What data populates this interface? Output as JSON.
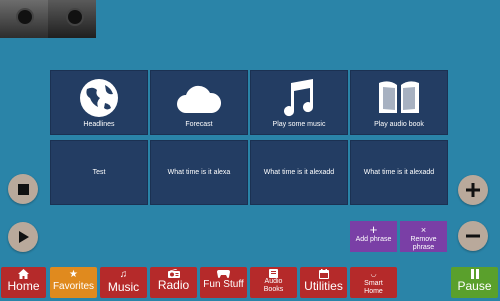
{
  "tiles": [
    {
      "label": "Headlines",
      "icon": "globe-icon"
    },
    {
      "label": "Forecast",
      "icon": "cloud-icon"
    },
    {
      "label": "Play some music",
      "icon": "music-note-icon"
    },
    {
      "label": "Play audio book",
      "icon": "book-icon"
    },
    {
      "label": "Test",
      "icon": ""
    },
    {
      "label": "What time is it alexa",
      "icon": ""
    },
    {
      "label": "What time is it alexadd",
      "icon": ""
    },
    {
      "label": "What time is it alexadd",
      "icon": ""
    }
  ],
  "phrases": {
    "add": "Add phrase",
    "remove": "Remove phrase",
    "add_symbol": "+",
    "remove_symbol": "×"
  },
  "nav": [
    {
      "label": "Home",
      "icon": "home-icon"
    },
    {
      "label": "Favorites",
      "icon": "star-icon"
    },
    {
      "label": "Music",
      "icon": "music-icon"
    },
    {
      "label": "Radio",
      "icon": "radio-icon"
    },
    {
      "label": "Fun Stuff",
      "icon": "gamepad-icon"
    },
    {
      "label": "Audio Books",
      "icon": "audiobook-icon"
    },
    {
      "label": "Utilities",
      "icon": "calendar-icon"
    },
    {
      "label": "Smart Home",
      "icon": "wifi-icon"
    },
    {
      "label": "Pause",
      "icon": "pause-icon"
    }
  ],
  "colors": {
    "background": "#2a84a8",
    "tile": "#233d63",
    "nav": "#b52a2a",
    "active": "#e08a1e",
    "pause": "#5aa02c",
    "phrase": "#7a3fa6"
  }
}
